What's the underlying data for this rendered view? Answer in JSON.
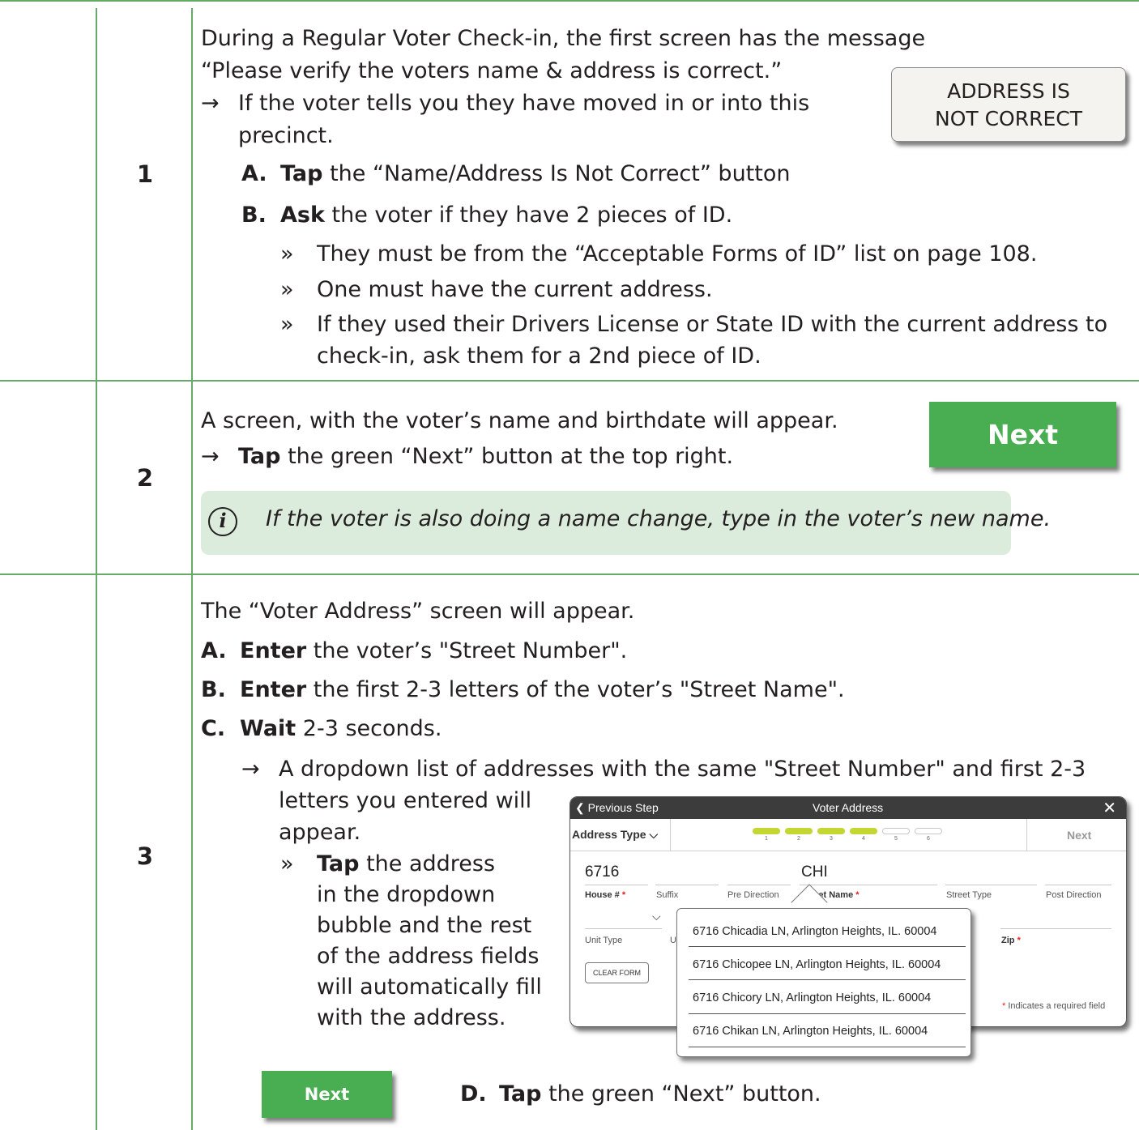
{
  "steps": {
    "s1": {
      "number": "1",
      "intro1": "During a Regular Voter Check-in, the first screen has the message",
      "intro2": "“Please verify the voters name & address is correct.”",
      "arrow_line1": "If the voter tells you they have moved in or into this",
      "arrow_line2": "precinct.",
      "a_label": "A.",
      "a_verb": "Tap",
      "a_rest": "the “Name/Address Is Not Correct” button",
      "b_label": "B.",
      "b_verb": "Ask",
      "b_rest": "the voter if they have 2 pieces of ID.",
      "bullets": [
        "They must be from the “Acceptable Forms of ID” list on page 108.",
        "One must have the current address.",
        "If they used their Drivers License or State ID with the current address to"
      ],
      "bullet3_cont": "check-in, ask them for a 2nd piece of ID.",
      "button_line1": "ADDRESS IS",
      "button_line2": "NOT CORRECT"
    },
    "s2": {
      "number": "2",
      "line1": "A screen, with the voter’s name and birthdate will appear.",
      "verb": "Tap",
      "rest": "the green “Next” button at the top right.",
      "info": "If the voter is also doing a name change, type in the voter’s new name.",
      "next_label": "Next"
    },
    "s3": {
      "number": "3",
      "intro": "The “Voter Address” screen will appear.",
      "a_label": "A.",
      "a_verb": "Enter",
      "a_rest": "the voter’s \"Street Number\".",
      "b_label": "B.",
      "b_verb": "Enter",
      "b_rest": "the first 2-3 letters of the voter’s \"Street Name\".",
      "c_label": "C.",
      "c_verb": "Wait",
      "c_rest": "2-3 seconds.",
      "arrow_line1": "A dropdown list of addresses with the same \"Street Number\" and first 2-3",
      "cont_lines": [
        "letters you entered will",
        "appear."
      ],
      "sub_verb": "Tap",
      "sub_first": "the address",
      "sub_lines": [
        "in the dropdown",
        "bubble and the rest",
        "of the address fields",
        "will automatically fill",
        "with the address."
      ],
      "d_label": "D.",
      "d_verb": "Tap",
      "d_rest": "the green “Next” button.",
      "next_label": "Next"
    }
  },
  "arrow_glyph": "→",
  "bullet_glyph": "»",
  "info_glyph": "i",
  "tablet": {
    "back_label": "Previous Step",
    "title": "Voter Address",
    "close_glyph": "✕",
    "address_type": "Address Type",
    "next_label": "Next",
    "progress": {
      "completed": 4,
      "total": 6
    },
    "step_numbers": [
      "1",
      "2",
      "3",
      "4",
      "5",
      "6"
    ],
    "house_value": "6716",
    "street_value": "CHI",
    "labels": {
      "house": "House #",
      "suffix": "Suffix",
      "pre_direction": "Pre Direction",
      "street_name": "Street Name",
      "street_type": "Street Type",
      "post_direction": "Post Direction",
      "unit_type": "Unit Type",
      "unit_partial": "U",
      "zip": "Zip"
    },
    "required_marker": "*",
    "clear_form": "CLEAR FORM",
    "required_note": "Indicates a required field"
  },
  "dropdown": {
    "options": [
      "6716 Chicadia LN, Arlington Heights, IL. 60004",
      "6716 Chicopee LN, Arlington Heights, IL. 60004",
      "6716 Chicory LN, Arlington Heights, IL. 60004",
      "6716 Chikan LN, Arlington Heights, IL. 60004"
    ]
  },
  "colors": {
    "rule": "#67a968",
    "button_green": "#49ad52",
    "info_bg": "#dcecdc",
    "progress_done": "#c4d631"
  }
}
